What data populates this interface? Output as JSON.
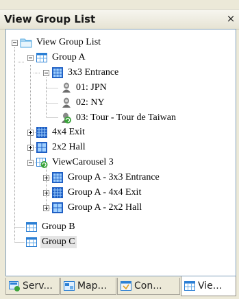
{
  "panel": {
    "title": "View Group List",
    "close_glyph": "×"
  },
  "tree": {
    "root": "View Group List",
    "group_a": "Group A",
    "entrance": "3x3 Entrance",
    "cam1": "01: JPN",
    "cam2": "02: NY",
    "tour": "03: Tour - Tour de Taiwan",
    "exit": "4x4 Exit",
    "hall": "2x2 Hall",
    "carousel": "ViewCarousel 3",
    "ca_entrance": "Group A - 3x3 Entrance",
    "ca_exit": "Group A - 4x4 Exit",
    "ca_hall": "Group A - 2x2 Hall",
    "group_b": "Group B",
    "group_c": "Group C"
  },
  "tabs": [
    {
      "label": "Serv...",
      "icon": "server-icon"
    },
    {
      "label": "Map...",
      "icon": "map-icon"
    },
    {
      "label": "Con...",
      "icon": "config-icon"
    },
    {
      "label": "Vie...",
      "icon": "view-icon"
    }
  ],
  "colors": {
    "accent_blue": "#2b6cd4",
    "folder_blue": "#4aa3df",
    "carousel_green": "#3aa33a",
    "selection_gray": "#e4e4e4"
  }
}
